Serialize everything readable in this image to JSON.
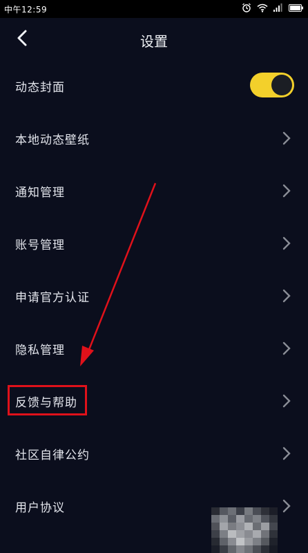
{
  "status_bar": {
    "time": "中午12:59"
  },
  "header": {
    "title": "设置"
  },
  "settings": {
    "dynamic_cover": {
      "label": "动态封面",
      "toggle_on": true
    },
    "items": [
      {
        "label": "本地动态壁纸"
      },
      {
        "label": "通知管理"
      },
      {
        "label": "账号管理"
      },
      {
        "label": "申请官方认证"
      },
      {
        "label": "隐私管理"
      },
      {
        "label": "反馈与帮助"
      },
      {
        "label": "社区自律公约"
      },
      {
        "label": "用户协议"
      }
    ]
  },
  "colors": {
    "background": "#0b0e1d",
    "toggle_on": "#f3d02b",
    "annotation_red": "#e0111a"
  }
}
